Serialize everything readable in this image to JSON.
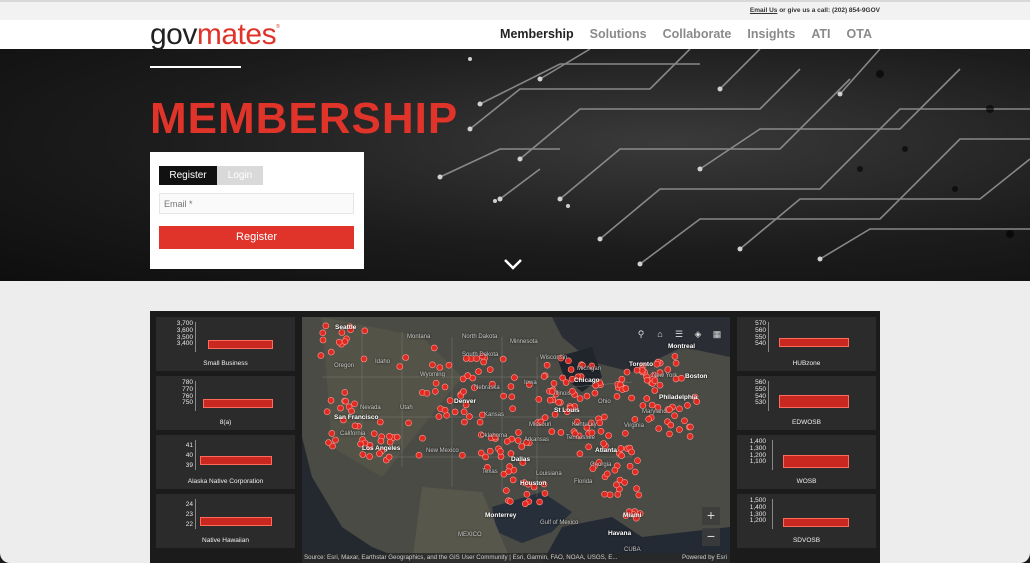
{
  "topbar": {
    "email_link": "Email Us",
    "contact_text": " or give us a call: (202) 854-9GOV"
  },
  "logo": {
    "gov": "gov",
    "mates": "mates",
    "tm": "®"
  },
  "nav": {
    "items": [
      "Membership",
      "Solutions",
      "Collaborate",
      "Insights",
      "ATI",
      "OTA"
    ],
    "active": "Membership"
  },
  "hero": {
    "title": "MEMBERSHIP"
  },
  "form": {
    "tab_register": "Register",
    "tab_login": "Login",
    "email_placeholder": "Email *",
    "submit_label": "Register"
  },
  "colors": {
    "brand_red": "#e0342a",
    "dark": "#111111",
    "panel_bg": "#2b2b2b"
  },
  "dashboard": {
    "left_panels": [
      {
        "name": "Small Business",
        "ticks": [
          "3,700",
          "3,600",
          "3,500",
          "3,400"
        ]
      },
      {
        "name": "8(a)",
        "ticks": [
          "780",
          "770",
          "760",
          "750"
        ]
      },
      {
        "name": "Alaska Native Corporation",
        "ticks": [
          "41",
          "40",
          "39"
        ]
      },
      {
        "name": "Native Hawaiian",
        "ticks": [
          "24",
          "23",
          "22"
        ]
      }
    ],
    "right_panels": [
      {
        "name": "HUBzone",
        "ticks": [
          "570",
          "560",
          "550",
          "540"
        ]
      },
      {
        "name": "EDWOSB",
        "ticks": [
          "560",
          "550",
          "540",
          "530"
        ]
      },
      {
        "name": "WOSB",
        "ticks": [
          "1,400",
          "1,300",
          "1,200",
          "1,100"
        ]
      },
      {
        "name": "SDVOSB",
        "ticks": [
          "1,500",
          "1,400",
          "1,300",
          "1,200"
        ]
      }
    ],
    "map": {
      "cities": [
        "Seattle",
        "San Francisco",
        "Los Angeles",
        "Denver",
        "Dallas",
        "Houston",
        "Chicago",
        "St Louis",
        "Atlanta",
        "Toronto",
        "Boston",
        "Philadelphia",
        "Miami",
        "Monterrey",
        "Havana",
        "Montreal",
        "Michigan"
      ],
      "states": [
        "Montana",
        "Oregon",
        "Idaho",
        "Wyoming",
        "Nevada",
        "Utah",
        "California",
        "North Dakota",
        "South Dakota",
        "Nebraska",
        "Kansas",
        "Oklahoma",
        "New Mexico",
        "Texas",
        "Minnesota",
        "Wisconsin",
        "Iowa",
        "Missouri",
        "Arkansas",
        "Louisiana",
        "Illinois",
        "Ohio",
        "Kentucky",
        "Tennessee",
        "Georgia",
        "Florida",
        "Virginia",
        "Maryland",
        "New York",
        "MEXICO",
        "Gulf of Mexico",
        "CUBA"
      ],
      "attribution": "Source: Esri, Maxar, Earthstar Geographics, and the GIS User Community | Esri, Garmin, FAO, NOAA, USGS, E...",
      "powered_by": "Powered by Esri",
      "zoom_in": "+",
      "zoom_out": "−"
    }
  }
}
